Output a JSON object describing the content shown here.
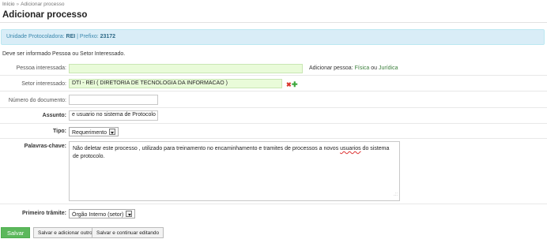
{
  "breadcrumb": {
    "home": "Início",
    "separator": "»",
    "current": "Adicionar processo"
  },
  "page_title": "Adicionar processo",
  "info": {
    "unit_label": "Unidade Protocoladora:",
    "unit_value": "REI",
    "divider": "|",
    "prefix_label": "Prefixo:",
    "prefix_value": "23172"
  },
  "notice": "Deve ser informado Pessoa ou Setor Interessado.",
  "form": {
    "pessoa": {
      "label": "Pessoa interessada:",
      "value": ""
    },
    "add_pessoa": {
      "prefix": "Adicionar pessoa:",
      "fisica": "Física",
      "or": "ou",
      "juridica": "Jurídica"
    },
    "setor": {
      "label": "Setor interessado:",
      "value": "DTI - REI ( DIRETORIA DE TECNOLOGIA DA INFORMACAO )"
    },
    "documento": {
      "label": "Número do documento:",
      "value": ""
    },
    "assunto": {
      "label": "Assunto:",
      "value": "e usuario no sistema de Protocolo"
    },
    "tipo": {
      "label": "Tipo:",
      "value": "Requerimento"
    },
    "palavras": {
      "label": "Palavras-chave:",
      "text_before": "Não deletar este processo , utilizado para treinamento no encaminhamento e tramites de processos a  novos ",
      "text_misspelled": "usuarios",
      "text_after": " do sistema de protocolo.",
      "grip": ".::"
    },
    "tramite": {
      "label": "Primeiro trâmite:",
      "value": "Órgão Interno (setor)"
    }
  },
  "buttons": {
    "save": "Salvar",
    "save_add": "Salvar e adicionar outro",
    "save_continue": "Salvar e continuar editando"
  },
  "icons": {
    "remove": "remove-x-icon",
    "add": "add-plus-icon"
  },
  "colors": {
    "info_bg": "#d9edf7",
    "info_text": "#3a87ad",
    "green_field": "#e9fbd9",
    "save_btn": "#5cb85c",
    "remove": "#d9352b",
    "add": "#3ea83e"
  }
}
